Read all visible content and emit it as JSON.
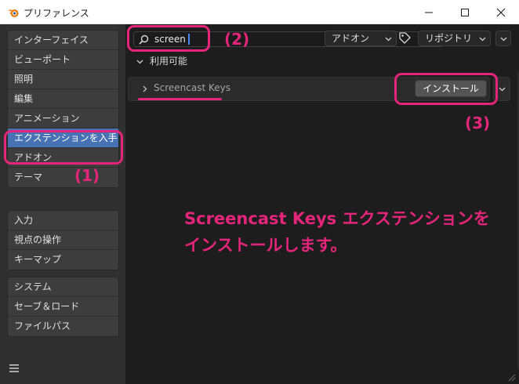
{
  "window": {
    "title": "プリファレンス",
    "colors": {
      "titlebar_bg": "#ffffff",
      "accent": "#4772b3",
      "annotation": "#e5247b"
    }
  },
  "sidebar": {
    "groups": [
      {
        "items": [
          {
            "label": "インターフェイス",
            "active": false
          },
          {
            "label": "ビューポート",
            "active": false
          },
          {
            "label": "照明",
            "active": false
          },
          {
            "label": "編集",
            "active": false
          },
          {
            "label": "アニメーション",
            "active": false
          },
          {
            "label": "エクステンションを入手",
            "active": true
          },
          {
            "label": "アドオン",
            "active": false
          },
          {
            "label": "テーマ",
            "active": false
          }
        ]
      },
      {
        "items": [
          {
            "label": "入力",
            "active": false
          },
          {
            "label": "視点の操作",
            "active": false
          },
          {
            "label": "キーマップ",
            "active": false
          }
        ]
      },
      {
        "items": [
          {
            "label": "システム",
            "active": false
          },
          {
            "label": "セーブ＆ロード",
            "active": false
          },
          {
            "label": "ファイルパス",
            "active": false
          }
        ]
      }
    ],
    "menu_icon": "hamburger-icon"
  },
  "toolbar": {
    "search_value": "screen",
    "search_icon": "search-icon",
    "clear_icon": "close-icon",
    "type_filter": "アドオン",
    "tag_icon": "tag-icon",
    "repo_filter": "リポジトリ"
  },
  "section": {
    "label": "利用可能"
  },
  "extension": {
    "name": "Screencast Keys",
    "install_label": "インストール"
  },
  "annotations": {
    "label_1": "(1)",
    "label_2": "(2)",
    "label_3": "(3)",
    "note_line1": "Screencast Keys エクステンションを",
    "note_line2": "インストールします。"
  }
}
